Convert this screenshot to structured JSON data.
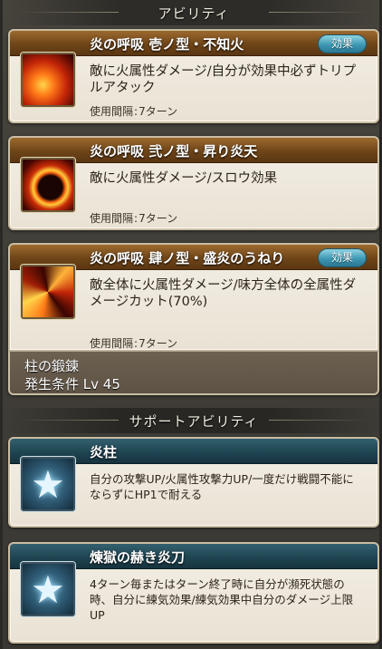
{
  "sections": {
    "abilities_header": "アビリティ",
    "support_header": "サポートアビリティ"
  },
  "badge_label": "効果",
  "cooldown_label": "使用間隔",
  "cooldown_sep": ":",
  "abilities": [
    {
      "name": "炎の呼吸 壱ノ型・不知火",
      "has_badge": true,
      "description": "敵に火属性ダメージ/自分が効果中必ずトリプルアタック",
      "cooldown": "7ターン",
      "icon": "flame-slash-icon"
    },
    {
      "name": "炎の呼吸 弐ノ型・昇り炎天",
      "has_badge": false,
      "description": "敵に火属性ダメージ/スロウ効果",
      "cooldown": "7ターン",
      "icon": "flame-arc-icon"
    },
    {
      "name": "炎の呼吸 肆ノ型・盛炎のうねり",
      "has_badge": true,
      "description": "敵全体に火属性ダメージ/味方全体の全属性ダメージカット(70%)",
      "cooldown": "7ターン",
      "icon": "flame-vortex-icon"
    }
  ],
  "trait": {
    "name": "柱の鍛錬",
    "condition": "発生条件 Lv 45"
  },
  "support_abilities": [
    {
      "name": "炎柱",
      "description": "自分の攻撃UP/火属性攻撃力UP/一度だけ戦闘不能にならずにHP1で耐える",
      "icon": "star-icon"
    },
    {
      "name": "煉獄の赫き炎刀",
      "description": "4ターン毎またはターン終了時に自分が瀕死状態の時、自分に練気効果/練気効果中自分のダメージ上限UP",
      "icon": "star-icon"
    }
  ],
  "colors": {
    "ability_title": "#6f4518",
    "support_title": "#1f4552",
    "badge": "#3d98b4",
    "card_bg": "#f3eee5"
  }
}
